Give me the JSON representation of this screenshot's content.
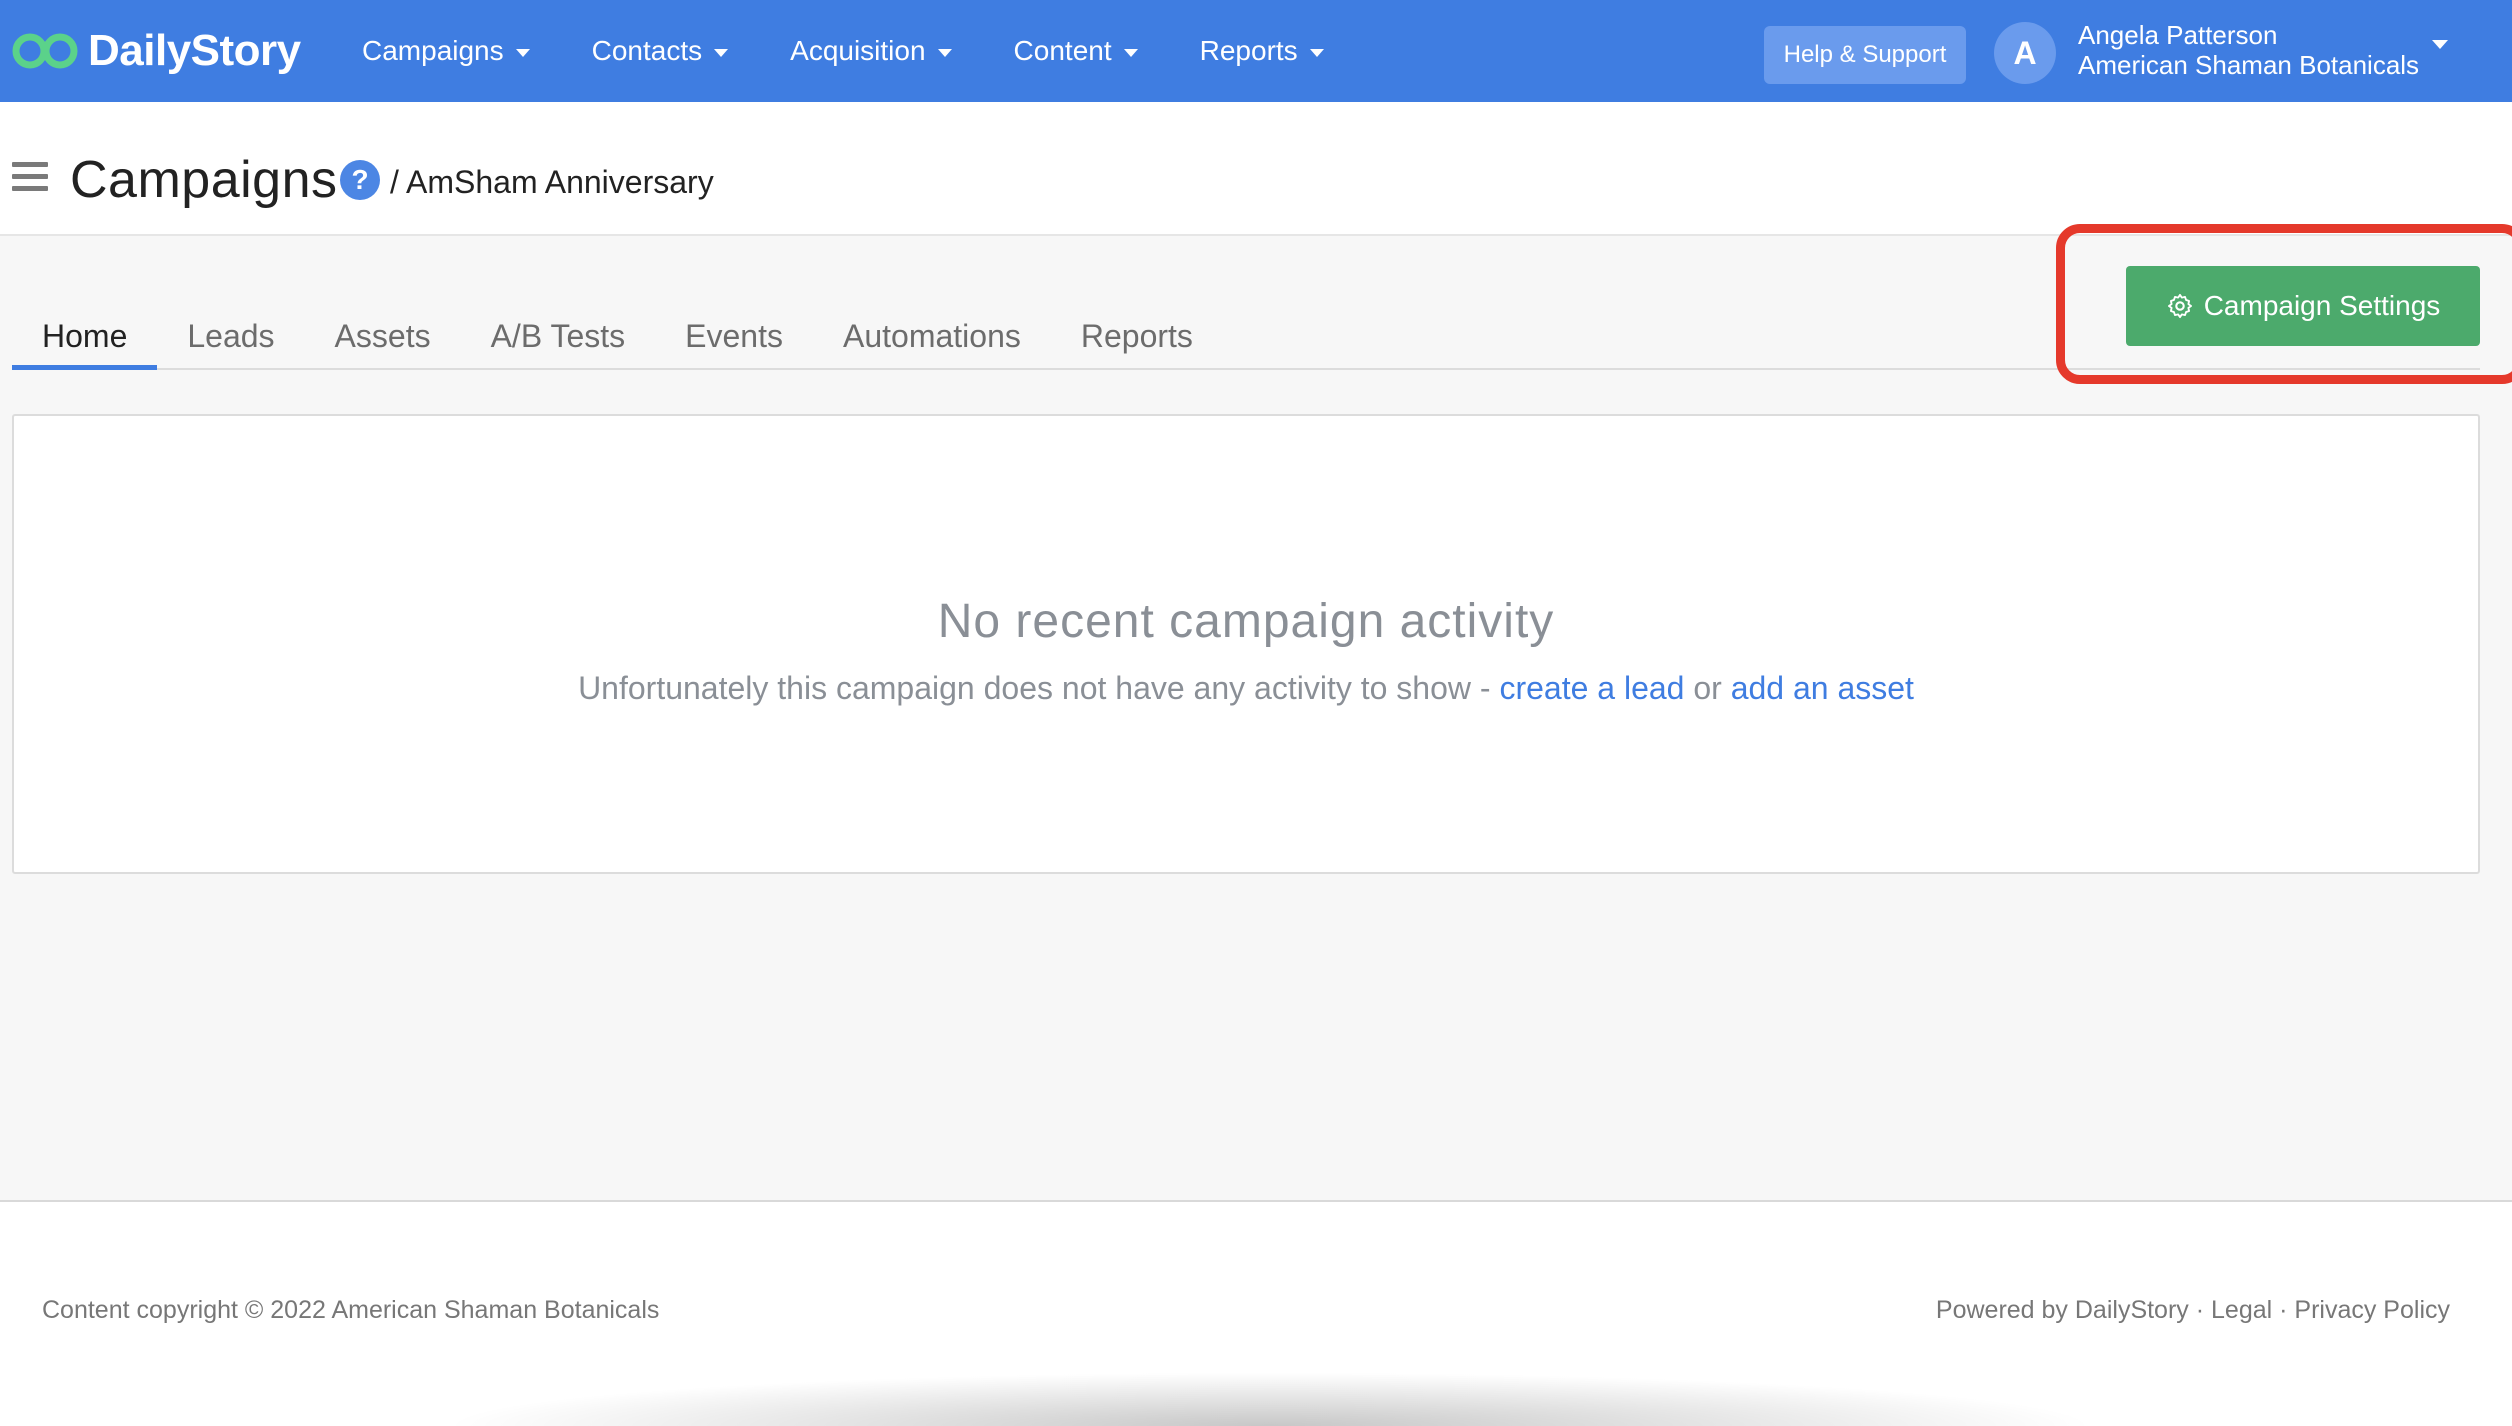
{
  "brand": {
    "name": "DailyStory"
  },
  "nav": {
    "items": [
      {
        "label": "Campaigns"
      },
      {
        "label": "Contacts"
      },
      {
        "label": "Acquisition"
      },
      {
        "label": "Content"
      },
      {
        "label": "Reports"
      }
    ],
    "help_label": "Help & Support",
    "user": {
      "initial": "A",
      "name": "Angela Patterson",
      "org": "American Shaman Botanicals"
    }
  },
  "header": {
    "title": "Campaigns",
    "help_glyph": "?",
    "breadcrumb": "/ AmSham Anniversary"
  },
  "tabs": [
    {
      "label": "Home",
      "active": true
    },
    {
      "label": "Leads"
    },
    {
      "label": "Assets"
    },
    {
      "label": "A/B Tests"
    },
    {
      "label": "Events"
    },
    {
      "label": "Automations"
    },
    {
      "label": "Reports"
    }
  ],
  "settings_button": {
    "label": "Campaign Settings",
    "icon": "gear-icon"
  },
  "empty_state": {
    "title": "No recent campaign activity",
    "text_before": "Unfortunately this campaign does not have any activity to show - ",
    "link_lead": "create a lead",
    "text_or": " or ",
    "link_asset": "add an asset"
  },
  "footer": {
    "copyright": "Content copyright © 2022 American Shaman Botanicals",
    "powered": "Powered by DailyStory",
    "sep": " · ",
    "legal": "Legal",
    "privacy": "Privacy Policy"
  },
  "colors": {
    "nav_bg": "#3f7de1",
    "settings_button": "#4caa6c",
    "highlight": "#e5392b",
    "link": "#3f7de1"
  }
}
